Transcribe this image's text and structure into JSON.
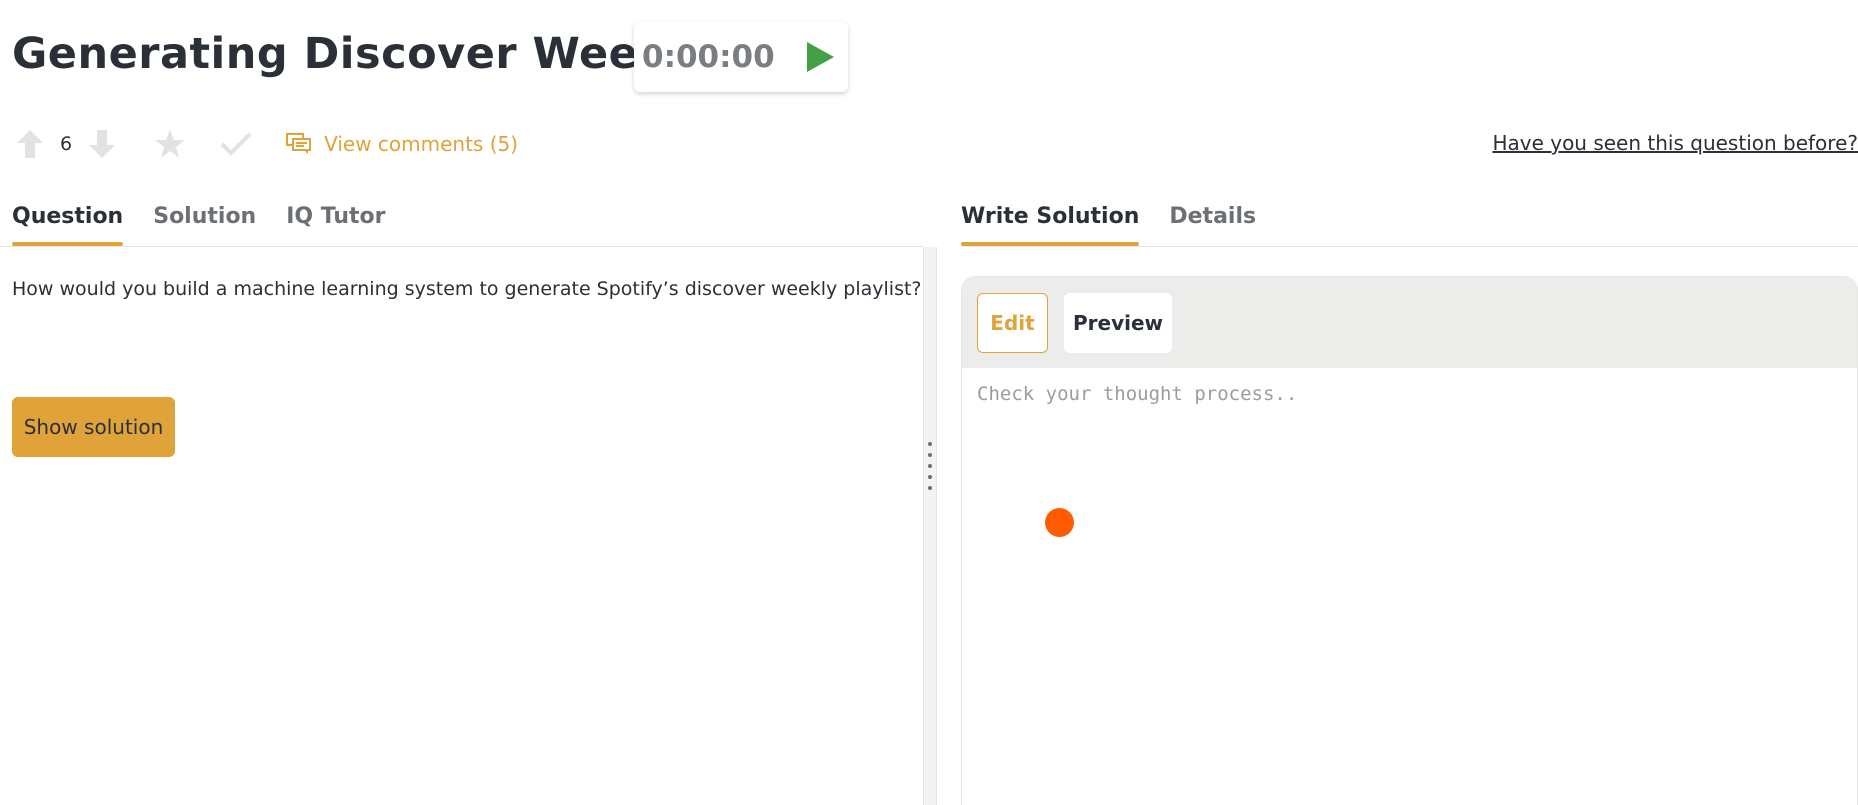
{
  "header": {
    "title": "Generating Discover Weekly",
    "timer": "0:00:00"
  },
  "actions": {
    "vote_count": "6",
    "comments_label": "View comments (5)",
    "seen_before_label": "Have you seen this question before?"
  },
  "left_tabs": [
    {
      "label": "Question",
      "active": true
    },
    {
      "label": "Solution",
      "active": false
    },
    {
      "label": "IQ Tutor",
      "active": false
    }
  ],
  "right_tabs": [
    {
      "label": "Write Solution",
      "active": true
    },
    {
      "label": "Details",
      "active": false
    }
  ],
  "question": {
    "text": "How would you build a machine learning system to generate Spotify’s discover weekly playlist?",
    "show_solution_label": "Show solution"
  },
  "editor": {
    "edit_label": "Edit",
    "preview_label": "Preview",
    "placeholder": "Check your thought process..",
    "value": ""
  },
  "colors": {
    "accent": "#e0a33a",
    "play": "#43a047",
    "cursor_dot": "#ff5b00",
    "icon_muted": "#e2e2e2"
  },
  "icons": [
    "play-icon",
    "upvote-icon",
    "downvote-icon",
    "star-icon",
    "check-icon",
    "comments-icon"
  ]
}
